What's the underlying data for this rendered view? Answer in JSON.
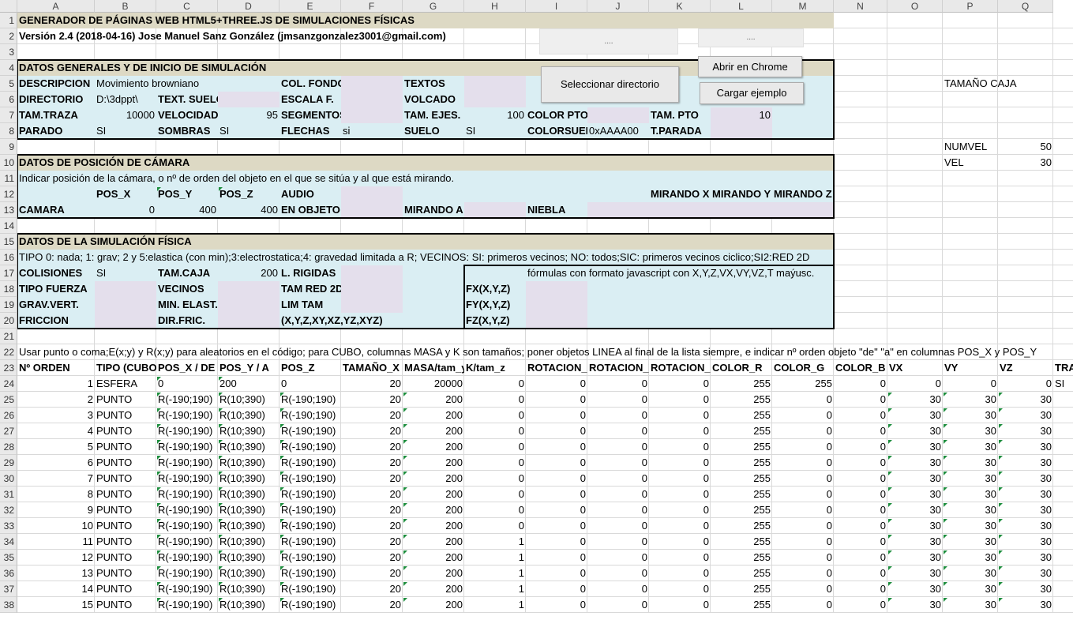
{
  "columns": [
    "A",
    "B",
    "C",
    "D",
    "E",
    "F",
    "G",
    "H",
    "I",
    "J",
    "K",
    "L",
    "M",
    "N",
    "O",
    "P",
    "Q"
  ],
  "rows": [
    1,
    2,
    3,
    4,
    5,
    6,
    7,
    8,
    9,
    10,
    11,
    12,
    13,
    14,
    15,
    16,
    17,
    18,
    19,
    20,
    21,
    22,
    23,
    24,
    25,
    26,
    27,
    28,
    29,
    30,
    31,
    32,
    33,
    34,
    35,
    36,
    37,
    38
  ],
  "buttons": {
    "placeholder1": "....",
    "placeholder2": "....",
    "abrir_chrome": "Abrir en Chrome",
    "seleccionar_directorio": "Seleccionar directorio",
    "cargar_ejemplo": "Cargar ejemplo"
  },
  "cells": [
    {
      "r": 1,
      "c": "A",
      "v": "GENERADOR DE PÁGINAS WEB HTML5+THREE.JS DE SIMULACIONES FÍSICAS",
      "b": 1,
      "o": 1
    },
    {
      "r": 2,
      "c": "A",
      "v": "Versión 2.4 (2018-04-16) Jose Manuel Sanz González (jmsanzgonzalez3001@gmail.com)",
      "b": 1,
      "o": 1
    },
    {
      "r": 4,
      "c": "A",
      "v": "DATOS GENERALES Y DE INICIO DE SIMULACIÓN",
      "b": 1,
      "o": 1
    },
    {
      "r": 5,
      "c": "A",
      "v": "DESCRIPCION",
      "b": 1
    },
    {
      "r": 5,
      "c": "B",
      "v": "Movimiento browniano",
      "o": 1
    },
    {
      "r": 5,
      "c": "E",
      "v": "COL. FONDO",
      "b": 1
    },
    {
      "r": 5,
      "c": "G",
      "v": "TEXTOS",
      "b": 1
    },
    {
      "r": 5,
      "c": "P",
      "v": "TAMAÑO CAJA",
      "o": 1
    },
    {
      "r": 6,
      "c": "A",
      "v": "DIRECTORIO",
      "b": 1
    },
    {
      "r": 6,
      "c": "B",
      "v": "D:\\3dppt\\"
    },
    {
      "r": 6,
      "c": "C",
      "v": "TEXT. SUELO",
      "b": 1
    },
    {
      "r": 6,
      "c": "E",
      "v": "ESCALA F.",
      "b": 1
    },
    {
      "r": 6,
      "c": "G",
      "v": "VOLCADO",
      "b": 1
    },
    {
      "r": 7,
      "c": "A",
      "v": "TAM.TRAZA",
      "b": 1
    },
    {
      "r": 7,
      "c": "B",
      "v": "10000",
      "a": "r"
    },
    {
      "r": 7,
      "c": "C",
      "v": "VELOCIDAD",
      "b": 1
    },
    {
      "r": 7,
      "c": "D",
      "v": "95",
      "a": "r"
    },
    {
      "r": 7,
      "c": "E",
      "v": "SEGMENTOS",
      "b": 1
    },
    {
      "r": 7,
      "c": "G",
      "v": "TAM. EJES.",
      "b": 1
    },
    {
      "r": 7,
      "c": "H",
      "v": "100",
      "a": "r"
    },
    {
      "r": 7,
      "c": "I",
      "v": "COLOR PTO",
      "b": 1
    },
    {
      "r": 7,
      "c": "K",
      "v": "TAM. PTO",
      "b": 1
    },
    {
      "r": 7,
      "c": "L",
      "v": "10",
      "a": "r"
    },
    {
      "r": 8,
      "c": "A",
      "v": "PARADO",
      "b": 1
    },
    {
      "r": 8,
      "c": "B",
      "v": "SI"
    },
    {
      "r": 8,
      "c": "C",
      "v": "SOMBRAS",
      "b": 1
    },
    {
      "r": 8,
      "c": "D",
      "v": "SI"
    },
    {
      "r": 8,
      "c": "E",
      "v": "FLECHAS",
      "b": 1
    },
    {
      "r": 8,
      "c": "F",
      "v": "si"
    },
    {
      "r": 8,
      "c": "G",
      "v": "SUELO",
      "b": 1
    },
    {
      "r": 8,
      "c": "H",
      "v": "SI"
    },
    {
      "r": 8,
      "c": "I",
      "v": "COLORSUELO",
      "b": 1
    },
    {
      "r": 8,
      "c": "J",
      "v": "0xAAAA00"
    },
    {
      "r": 8,
      "c": "K",
      "v": "T.PARADA",
      "b": 1
    },
    {
      "r": 9,
      "c": "P",
      "v": "NUMVEL"
    },
    {
      "r": 9,
      "c": "Q",
      "v": "50",
      "a": "r"
    },
    {
      "r": 10,
      "c": "A",
      "v": "DATOS DE POSICIÓN DE CÁMARA",
      "b": 1,
      "o": 1
    },
    {
      "r": 10,
      "c": "P",
      "v": "VEL"
    },
    {
      "r": 10,
      "c": "Q",
      "v": "30",
      "a": "r"
    },
    {
      "r": 11,
      "c": "A",
      "v": "Indicar posición de la cámara, o nº de orden del objeto en el que se sitúa y al que está mirando.",
      "o": 1
    },
    {
      "r": 12,
      "c": "B",
      "v": "POS_X",
      "b": 1
    },
    {
      "r": 12,
      "c": "C",
      "v": "POS_Y",
      "b": 1
    },
    {
      "r": 12,
      "c": "D",
      "v": "POS_Z",
      "b": 1
    },
    {
      "r": 12,
      "c": "E",
      "v": "AUDIO",
      "b": 1
    },
    {
      "r": 12,
      "c": "K",
      "v": "MIRANDO X",
      "b": 1
    },
    {
      "r": 12,
      "c": "L",
      "v": "MIRANDO Y",
      "b": 1
    },
    {
      "r": 12,
      "c": "M",
      "v": "MIRANDO Z",
      "b": 1
    },
    {
      "r": 13,
      "c": "A",
      "v": "CAMARA",
      "b": 1
    },
    {
      "r": 13,
      "c": "B",
      "v": "0",
      "a": "r"
    },
    {
      "r": 13,
      "c": "C",
      "v": "400",
      "a": "r"
    },
    {
      "r": 13,
      "c": "D",
      "v": "400",
      "a": "r"
    },
    {
      "r": 13,
      "c": "E",
      "v": "EN OBJETO",
      "b": 1
    },
    {
      "r": 13,
      "c": "G",
      "v": "MIRANDO A",
      "b": 1
    },
    {
      "r": 13,
      "c": "I",
      "v": "NIEBLA",
      "b": 1
    },
    {
      "r": 15,
      "c": "A",
      "v": "DATOS DE LA SIMULACIÓN FÍSICA",
      "b": 1,
      "o": 1
    },
    {
      "r": 16,
      "c": "A",
      "v": "TIPO 0: nada; 1: grav; 2 y 5:elastica (con min);3:electrostatica;4: gravedad limitada a R; VECINOS: SI: primeros vecinos; NO: todos;SIC: primeros vecinos ciclico;SI2:RED 2D",
      "o": 1
    },
    {
      "r": 17,
      "c": "A",
      "v": "COLISIONES",
      "b": 1
    },
    {
      "r": 17,
      "c": "B",
      "v": "SI"
    },
    {
      "r": 17,
      "c": "C",
      "v": "TAM.CAJA",
      "b": 1
    },
    {
      "r": 17,
      "c": "D",
      "v": "200",
      "a": "r"
    },
    {
      "r": 17,
      "c": "E",
      "v": "L. RIGIDAS",
      "b": 1
    },
    {
      "r": 17,
      "c": "I",
      "v": "fórmulas con formato javascript con X,Y,Z,VX,VY,VZ,T maýusc.",
      "o": 1
    },
    {
      "r": 18,
      "c": "A",
      "v": "TIPO FUERZA",
      "b": 1
    },
    {
      "r": 18,
      "c": "C",
      "v": "VECINOS",
      "b": 1
    },
    {
      "r": 18,
      "c": "E",
      "v": "TAM RED 2D",
      "b": 1
    },
    {
      "r": 18,
      "c": "H",
      "v": "FX(X,Y,Z)",
      "b": 1
    },
    {
      "r": 19,
      "c": "A",
      "v": "GRAV.VERT.",
      "b": 1
    },
    {
      "r": 19,
      "c": "C",
      "v": "MIN. ELAST.",
      "b": 1
    },
    {
      "r": 19,
      "c": "E",
      "v": "LIM TAM",
      "b": 1
    },
    {
      "r": 19,
      "c": "H",
      "v": "FY(X,Y,Z)",
      "b": 1
    },
    {
      "r": 20,
      "c": "A",
      "v": "FRICCION",
      "b": 1
    },
    {
      "r": 20,
      "c": "C",
      "v": "DIR.FRIC.",
      "b": 1
    },
    {
      "r": 20,
      "c": "E",
      "v": "(X,Y,Z,XY,XZ,YZ,XYZ)",
      "b": 1,
      "o": 1
    },
    {
      "r": 20,
      "c": "H",
      "v": "FZ(X,Y,Z)",
      "b": 1
    },
    {
      "r": 22,
      "c": "A",
      "v": "Usar punto o coma;E(x;y) y R(x;y) para aleatorios en el código; para CUBO, columnas MASA y K son tamaños; poner objetos LINEA al final de la lista siempre, e indicar nº orden objeto \"de\" \"a\" en columnas POS_X y POS_Y",
      "o": 1
    },
    {
      "r": 23,
      "c": "A",
      "v": "Nº ORDEN",
      "b": 1
    },
    {
      "r": 23,
      "c": "B",
      "v": "TIPO (CUBO,ESFERA,PUNTO,LINEA)",
      "b": 1
    },
    {
      "r": 23,
      "c": "C",
      "v": "POS_X / DE",
      "b": 1
    },
    {
      "r": 23,
      "c": "D",
      "v": "POS_Y / A",
      "b": 1
    },
    {
      "r": 23,
      "c": "E",
      "v": "POS_Z",
      "b": 1
    },
    {
      "r": 23,
      "c": "F",
      "v": "TAMAÑO_X",
      "b": 1
    },
    {
      "r": 23,
      "c": "G",
      "v": "MASA/tam_y",
      "b": 1
    },
    {
      "r": 23,
      "c": "H",
      "v": "K/tam_z",
      "b": 1
    },
    {
      "r": 23,
      "c": "I",
      "v": "ROTACION_X",
      "b": 1
    },
    {
      "r": 23,
      "c": "J",
      "v": "ROTACION_Y",
      "b": 1
    },
    {
      "r": 23,
      "c": "K",
      "v": "ROTACION_Z",
      "b": 1
    },
    {
      "r": 23,
      "c": "L",
      "v": "COLOR_R",
      "b": 1
    },
    {
      "r": 23,
      "c": "M",
      "v": "COLOR_G",
      "b": 1
    },
    {
      "r": 23,
      "c": "N",
      "v": "COLOR_B",
      "b": 1
    },
    {
      "r": 23,
      "c": "O",
      "v": "VX",
      "b": 1
    },
    {
      "r": 23,
      "c": "P",
      "v": "VY",
      "b": 1
    },
    {
      "r": 23,
      "c": "Q",
      "v": "VZ",
      "b": 1
    },
    {
      "r": 23,
      "c": "R",
      "v": "TRA",
      "b": 1
    }
  ],
  "table": [
    [
      "1",
      "ESFERA",
      "0",
      "200",
      "0",
      "20",
      "20000",
      "0",
      "0",
      "0",
      "0",
      "255",
      "255",
      "0",
      "0",
      "0",
      "0",
      "SI"
    ],
    [
      "2",
      "PUNTO",
      "R(-190;190)",
      "R(10;390)",
      "R(-190;190)",
      "20",
      "200",
      "0",
      "0",
      "0",
      "0",
      "255",
      "0",
      "0",
      "30",
      "30",
      "30",
      ""
    ],
    [
      "3",
      "PUNTO",
      "R(-190;190)",
      "R(10;390)",
      "R(-190;190)",
      "20",
      "200",
      "0",
      "0",
      "0",
      "0",
      "255",
      "0",
      "0",
      "30",
      "30",
      "30",
      ""
    ],
    [
      "4",
      "PUNTO",
      "R(-190;190)",
      "R(10;390)",
      "R(-190;190)",
      "20",
      "200",
      "0",
      "0",
      "0",
      "0",
      "255",
      "0",
      "0",
      "30",
      "30",
      "30",
      ""
    ],
    [
      "5",
      "PUNTO",
      "R(-190;190)",
      "R(10;390)",
      "R(-190;190)",
      "20",
      "200",
      "0",
      "0",
      "0",
      "0",
      "255",
      "0",
      "0",
      "30",
      "30",
      "30",
      ""
    ],
    [
      "6",
      "PUNTO",
      "R(-190;190)",
      "R(10;390)",
      "R(-190;190)",
      "20",
      "200",
      "0",
      "0",
      "0",
      "0",
      "255",
      "0",
      "0",
      "30",
      "30",
      "30",
      ""
    ],
    [
      "7",
      "PUNTO",
      "R(-190;190)",
      "R(10;390)",
      "R(-190;190)",
      "20",
      "200",
      "0",
      "0",
      "0",
      "0",
      "255",
      "0",
      "0",
      "30",
      "30",
      "30",
      ""
    ],
    [
      "8",
      "PUNTO",
      "R(-190;190)",
      "R(10;390)",
      "R(-190;190)",
      "20",
      "200",
      "0",
      "0",
      "0",
      "0",
      "255",
      "0",
      "0",
      "30",
      "30",
      "30",
      ""
    ],
    [
      "9",
      "PUNTO",
      "R(-190;190)",
      "R(10;390)",
      "R(-190;190)",
      "20",
      "200",
      "0",
      "0",
      "0",
      "0",
      "255",
      "0",
      "0",
      "30",
      "30",
      "30",
      ""
    ],
    [
      "10",
      "PUNTO",
      "R(-190;190)",
      "R(10;390)",
      "R(-190;190)",
      "20",
      "200",
      "0",
      "0",
      "0",
      "0",
      "255",
      "0",
      "0",
      "30",
      "30",
      "30",
      ""
    ],
    [
      "11",
      "PUNTO",
      "R(-190;190)",
      "R(10;390)",
      "R(-190;190)",
      "20",
      "200",
      "1",
      "0",
      "0",
      "0",
      "255",
      "0",
      "0",
      "30",
      "30",
      "30",
      ""
    ],
    [
      "12",
      "PUNTO",
      "R(-190;190)",
      "R(10;390)",
      "R(-190;190)",
      "20",
      "200",
      "1",
      "0",
      "0",
      "0",
      "255",
      "0",
      "0",
      "30",
      "30",
      "30",
      ""
    ],
    [
      "13",
      "PUNTO",
      "R(-190;190)",
      "R(10;390)",
      "R(-190;190)",
      "20",
      "200",
      "1",
      "0",
      "0",
      "0",
      "255",
      "0",
      "0",
      "30",
      "30",
      "30",
      ""
    ],
    [
      "14",
      "PUNTO",
      "R(-190;190)",
      "R(10;390)",
      "R(-190;190)",
      "20",
      "200",
      "1",
      "0",
      "0",
      "0",
      "255",
      "0",
      "0",
      "30",
      "30",
      "30",
      ""
    ],
    [
      "15",
      "PUNTO",
      "R(-190;190)",
      "R(10;390)",
      "R(-190;190)",
      "20",
      "200",
      "1",
      "0",
      "0",
      "0",
      "255",
      "0",
      "0",
      "30",
      "30",
      "30",
      ""
    ]
  ],
  "colors": {
    "tan": "#ddd9c4",
    "blue": "#daeef3",
    "lavender": "#e4dfec",
    "comment_marker": "#1e8e3e"
  }
}
